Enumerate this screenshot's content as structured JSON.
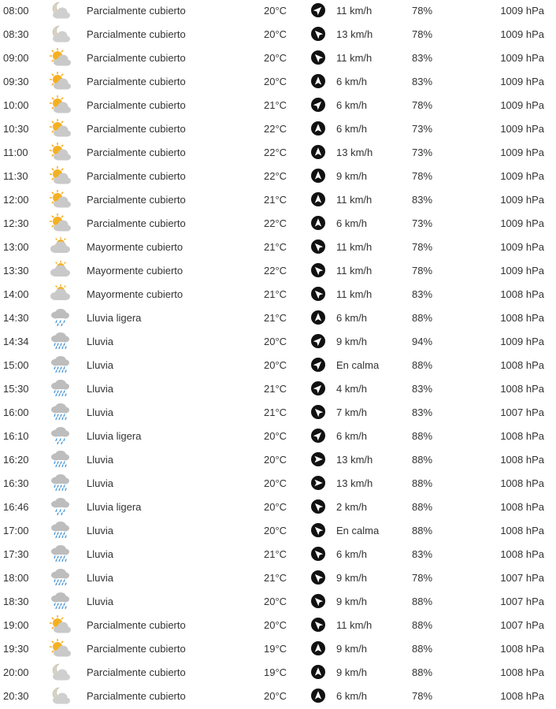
{
  "rows": [
    {
      "time": "08:00",
      "icon": "moon-cloud-icon",
      "condition": "Parcialmente cubierto",
      "temp": "20°C",
      "wind_dir": 45,
      "wind": "11 km/h",
      "humidity": "78%",
      "pressure": "1009 hPa"
    },
    {
      "time": "08:30",
      "icon": "moon-cloud-icon",
      "condition": "Parcialmente cubierto",
      "temp": "20°C",
      "wind_dir": -45,
      "wind": "13 km/h",
      "humidity": "78%",
      "pressure": "1009 hPa"
    },
    {
      "time": "09:00",
      "icon": "sun-cloud-icon",
      "condition": "Parcialmente cubierto",
      "temp": "20°C",
      "wind_dir": -45,
      "wind": "11 km/h",
      "humidity": "83%",
      "pressure": "1009 hPa"
    },
    {
      "time": "09:30",
      "icon": "sun-cloud-icon",
      "condition": "Parcialmente cubierto",
      "temp": "20°C",
      "wind_dir": 0,
      "wind": "6 km/h",
      "humidity": "83%",
      "pressure": "1009 hPa"
    },
    {
      "time": "10:00",
      "icon": "sun-cloud-icon",
      "condition": "Parcialmente cubierto",
      "temp": "21°C",
      "wind_dir": 45,
      "wind": "6 km/h",
      "humidity": "78%",
      "pressure": "1009 hPa"
    },
    {
      "time": "10:30",
      "icon": "sun-cloud-icon",
      "condition": "Parcialmente cubierto",
      "temp": "22°C",
      "wind_dir": 0,
      "wind": "6 km/h",
      "humidity": "73%",
      "pressure": "1009 hPa"
    },
    {
      "time": "11:00",
      "icon": "sun-cloud-icon",
      "condition": "Parcialmente cubierto",
      "temp": "22°C",
      "wind_dir": 0,
      "wind": "13 km/h",
      "humidity": "73%",
      "pressure": "1009 hPa"
    },
    {
      "time": "11:30",
      "icon": "sun-cloud-icon",
      "condition": "Parcialmente cubierto",
      "temp": "22°C",
      "wind_dir": 0,
      "wind": "9 km/h",
      "humidity": "78%",
      "pressure": "1009 hPa"
    },
    {
      "time": "12:00",
      "icon": "sun-cloud-icon",
      "condition": "Parcialmente cubierto",
      "temp": "21°C",
      "wind_dir": 0,
      "wind": "11 km/h",
      "humidity": "83%",
      "pressure": "1009 hPa"
    },
    {
      "time": "12:30",
      "icon": "sun-cloud-icon",
      "condition": "Parcialmente cubierto",
      "temp": "22°C",
      "wind_dir": 0,
      "wind": "6 km/h",
      "humidity": "73%",
      "pressure": "1009 hPa"
    },
    {
      "time": "13:00",
      "icon": "sun-heavy-cloud-icon",
      "condition": "Mayormente cubierto",
      "temp": "21°C",
      "wind_dir": -45,
      "wind": "11 km/h",
      "humidity": "78%",
      "pressure": "1009 hPa"
    },
    {
      "time": "13:30",
      "icon": "sun-heavy-cloud-icon",
      "condition": "Mayormente cubierto",
      "temp": "22°C",
      "wind_dir": -45,
      "wind": "11 km/h",
      "humidity": "78%",
      "pressure": "1009 hPa"
    },
    {
      "time": "14:00",
      "icon": "sun-heavy-cloud-icon",
      "condition": "Mayormente cubierto",
      "temp": "21°C",
      "wind_dir": -45,
      "wind": "11 km/h",
      "humidity": "83%",
      "pressure": "1008 hPa"
    },
    {
      "time": "14:30",
      "icon": "light-rain-icon",
      "condition": "Lluvia ligera",
      "temp": "21°C",
      "wind_dir": 0,
      "wind": "6 km/h",
      "humidity": "88%",
      "pressure": "1008 hPa"
    },
    {
      "time": "14:34",
      "icon": "rain-icon",
      "condition": "Lluvia",
      "temp": "20°C",
      "wind_dir": 45,
      "wind": "9 km/h",
      "humidity": "94%",
      "pressure": "1009 hPa"
    },
    {
      "time": "15:00",
      "icon": "rain-icon",
      "condition": "Lluvia",
      "temp": "20°C",
      "wind_dir": 45,
      "wind": "En calma",
      "humidity": "88%",
      "pressure": "1008 hPa"
    },
    {
      "time": "15:30",
      "icon": "rain-icon",
      "condition": "Lluvia",
      "temp": "21°C",
      "wind_dir": 45,
      "wind": "4 km/h",
      "humidity": "83%",
      "pressure": "1008 hPa"
    },
    {
      "time": "16:00",
      "icon": "rain-icon",
      "condition": "Lluvia",
      "temp": "21°C",
      "wind_dir": -45,
      "wind": "7 km/h",
      "humidity": "83%",
      "pressure": "1007 hPa"
    },
    {
      "time": "16:10",
      "icon": "light-rain-icon",
      "condition": "Lluvia ligera",
      "temp": "20°C",
      "wind_dir": 45,
      "wind": "6 km/h",
      "humidity": "88%",
      "pressure": "1008 hPa"
    },
    {
      "time": "16:20",
      "icon": "rain-icon",
      "condition": "Lluvia",
      "temp": "20°C",
      "wind_dir": 90,
      "wind": "13 km/h",
      "humidity": "88%",
      "pressure": "1008 hPa"
    },
    {
      "time": "16:30",
      "icon": "rain-icon",
      "condition": "Lluvia",
      "temp": "20°C",
      "wind_dir": 90,
      "wind": "13 km/h",
      "humidity": "88%",
      "pressure": "1008 hPa"
    },
    {
      "time": "16:46",
      "icon": "light-rain-icon",
      "condition": "Lluvia ligera",
      "temp": "20°C",
      "wind_dir": -45,
      "wind": "2 km/h",
      "humidity": "88%",
      "pressure": "1008 hPa"
    },
    {
      "time": "17:00",
      "icon": "rain-icon",
      "condition": "Lluvia",
      "temp": "20°C",
      "wind_dir": -45,
      "wind": "En calma",
      "humidity": "88%",
      "pressure": "1008 hPa"
    },
    {
      "time": "17:30",
      "icon": "rain-icon",
      "condition": "Lluvia",
      "temp": "21°C",
      "wind_dir": -45,
      "wind": "6 km/h",
      "humidity": "83%",
      "pressure": "1008 hPa"
    },
    {
      "time": "18:00",
      "icon": "rain-icon",
      "condition": "Lluvia",
      "temp": "21°C",
      "wind_dir": -45,
      "wind": "9 km/h",
      "humidity": "78%",
      "pressure": "1007 hPa"
    },
    {
      "time": "18:30",
      "icon": "rain-icon",
      "condition": "Lluvia",
      "temp": "20°C",
      "wind_dir": -45,
      "wind": "9 km/h",
      "humidity": "88%",
      "pressure": "1007 hPa"
    },
    {
      "time": "19:00",
      "icon": "sun-cloud-icon",
      "condition": "Parcialmente cubierto",
      "temp": "20°C",
      "wind_dir": -45,
      "wind": "11 km/h",
      "humidity": "88%",
      "pressure": "1007 hPa"
    },
    {
      "time": "19:30",
      "icon": "sun-cloud-icon",
      "condition": "Parcialmente cubierto",
      "temp": "19°C",
      "wind_dir": 0,
      "wind": "9 km/h",
      "humidity": "88%",
      "pressure": "1008 hPa"
    },
    {
      "time": "20:00",
      "icon": "moon-cloud-icon",
      "condition": "Parcialmente cubierto",
      "temp": "19°C",
      "wind_dir": 0,
      "wind": "9 km/h",
      "humidity": "88%",
      "pressure": "1008 hPa"
    },
    {
      "time": "20:30",
      "icon": "moon-cloud-icon",
      "condition": "Parcialmente cubierto",
      "temp": "20°C",
      "wind_dir": 0,
      "wind": "6 km/h",
      "humidity": "78%",
      "pressure": "1008 hPa"
    }
  ],
  "colors": {
    "text": "#333333",
    "sun": "#f5b021",
    "cloud": "#c9c9c9",
    "moon": "#d8d3c3",
    "rain": "#3a8fd6",
    "arrow_bg": "#111111"
  }
}
